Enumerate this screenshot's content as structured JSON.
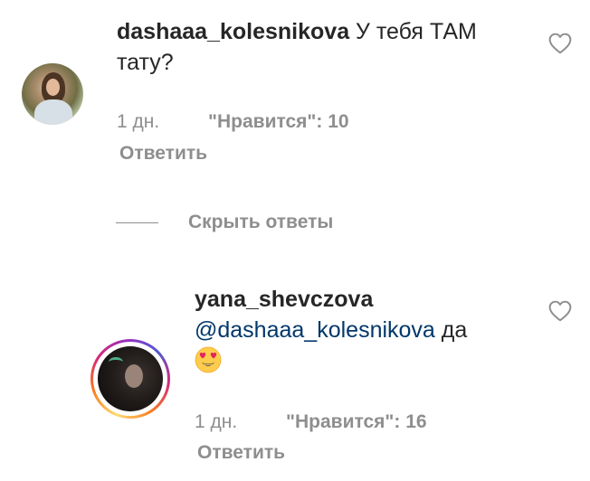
{
  "comments": [
    {
      "username": "dashaaa_kolesnikova",
      "text": "У тебя ТАМ тату?",
      "time": "1 дн.",
      "likes": "\"Нравится\": 10",
      "reply_label": "Ответить",
      "avatar_story_ring": false
    },
    {
      "username": "yana_shevczova",
      "mention": "@dashaaa_kolesnikova",
      "text": "да",
      "emoji": "smiling-face-with-heart-eyes",
      "time": "1 дн.",
      "likes": "\"Нравится\": 16",
      "reply_label": "Ответить",
      "avatar_story_ring": true
    }
  ],
  "replies_toggle": {
    "label": "Скрыть ответы"
  },
  "colors": {
    "text": "#262626",
    "secondary": "#8e8e8e",
    "mention": "#00376b",
    "background": "#ffffff"
  }
}
